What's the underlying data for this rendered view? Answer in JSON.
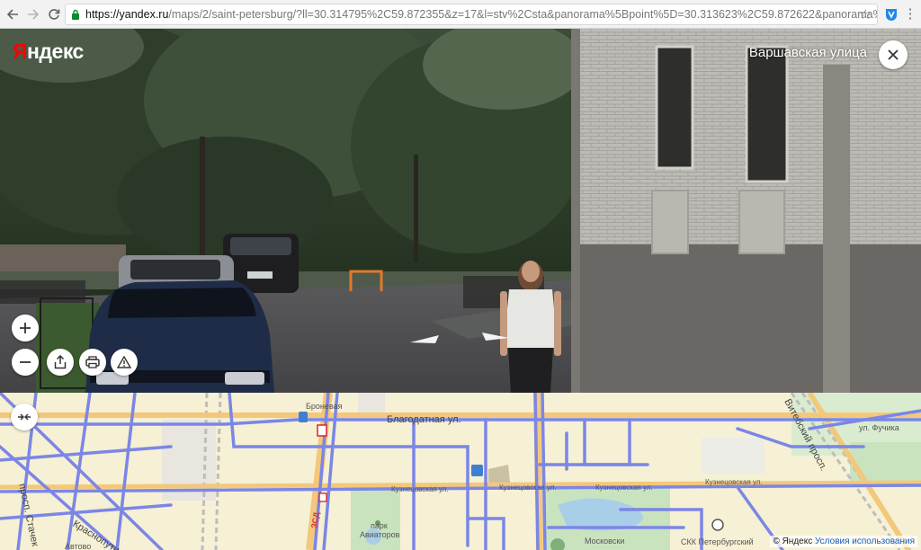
{
  "browser": {
    "url_host": "https://yandex.ru",
    "url_rest": "/maps/2/saint-petersburg/?ll=30.314795%2C59.872355&z=17&l=stv%2Csta&panorama%5Bpoint%5D=30.313623%2C59.872622&panorama%...",
    "icons": [
      "back-arrow-icon",
      "forward-arrow-icon",
      "reload-icon",
      "lock-icon",
      "star-icon",
      "extension-icon",
      "menu-icon"
    ]
  },
  "panorama": {
    "logo_first": "Я",
    "logo_rest": "ндекс",
    "street_name": "Варшавская улица",
    "controls": [
      "zoom-in",
      "zoom-out",
      "share",
      "print",
      "report-problem",
      "close"
    ]
  },
  "map": {
    "streets": {
      "blagodatnaya": "Благодатная ул.",
      "bronevaya": "Броневая",
      "kuznetsovskaya_1": "Кузнецовская ул.",
      "kuznetsovskaya_2": "Кузнецовская ул.",
      "kuznetsovskaya_3": "Кузнецовская ул.",
      "kuznetsovskaya_4": "Кузнецовская ул.",
      "krasnoputilovskaya": "Краснопутиловс",
      "stachek": "просп. Стачек",
      "vitebsky": "Витебский просп.",
      "park": "парк",
      "aviatorov": "Авиаторов",
      "moskovsky": "Московски",
      "skk": "СКК Петербургский",
      "fuchika": "ул. Фучика",
      "avtovo": "Автово",
      "zsd": "ЗСД"
    },
    "attribution": "© Яндекс",
    "terms": "Условия использования"
  },
  "colors": {
    "yandex_red": "#ff0000",
    "road_blue": "#7b86e6",
    "map_bg": "#f6f0d4",
    "park_green": "#c9e3bf"
  }
}
